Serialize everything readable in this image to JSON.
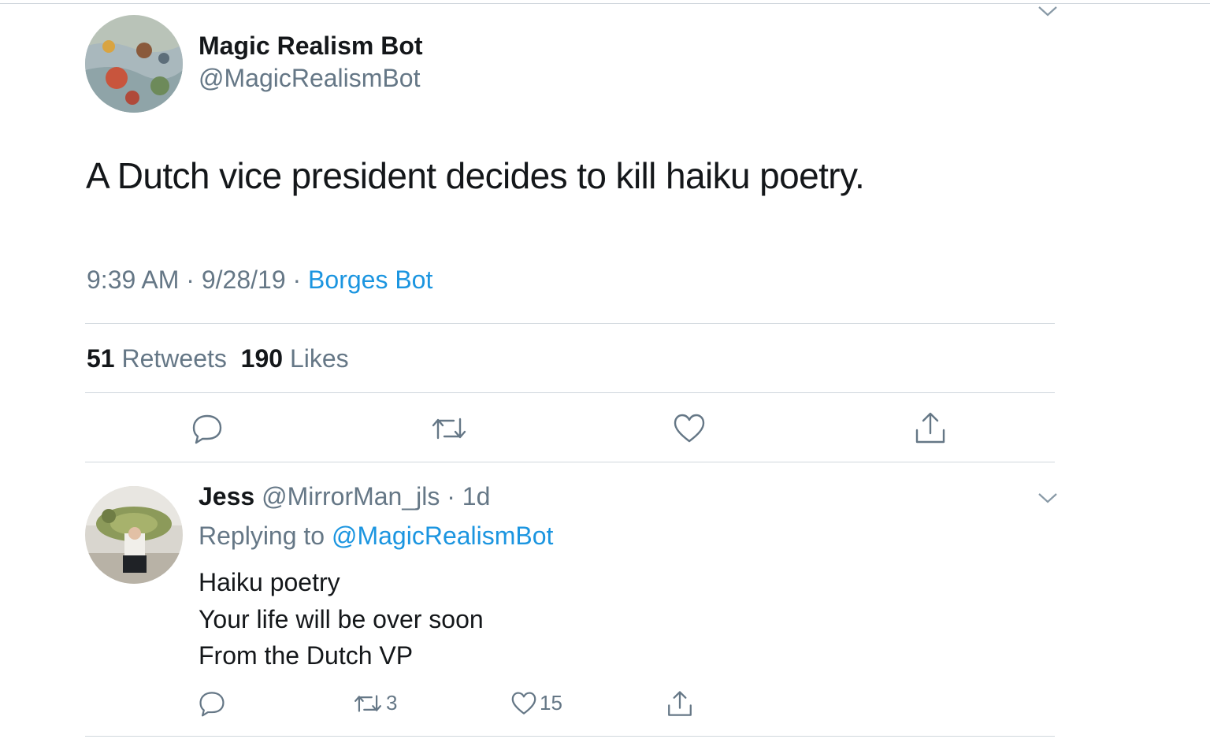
{
  "main_tweet": {
    "author_name": "Magic Realism Bot",
    "author_handle": "@MagicRealismBot",
    "text": "A Dutch vice president decides to kill haiku poetry.",
    "time": "9:39 AM",
    "date": "9/28/19",
    "source": "Borges Bot",
    "retweets_count": "51",
    "retweets_label": "Retweets",
    "likes_count": "190",
    "likes_label": "Likes"
  },
  "reply_tweet": {
    "author_name": "Jess",
    "author_handle": "@MirrorMan_jls",
    "age": "1d",
    "replying_prefix": "Replying to",
    "replying_to": "@MagicRealismBot",
    "lines": [
      "Haiku poetry",
      "Your life will be over soon",
      "From the Dutch VP"
    ],
    "retweet_count": "3",
    "like_count": "15"
  },
  "separator": "·",
  "colors": {
    "accent": "#1b95e0",
    "secondary_text": "#657786",
    "primary_text": "#14171a",
    "divider": "#d0d7dd"
  },
  "icons": [
    "chevron-down-icon",
    "reply-icon",
    "retweet-icon",
    "like-icon",
    "share-icon"
  ]
}
